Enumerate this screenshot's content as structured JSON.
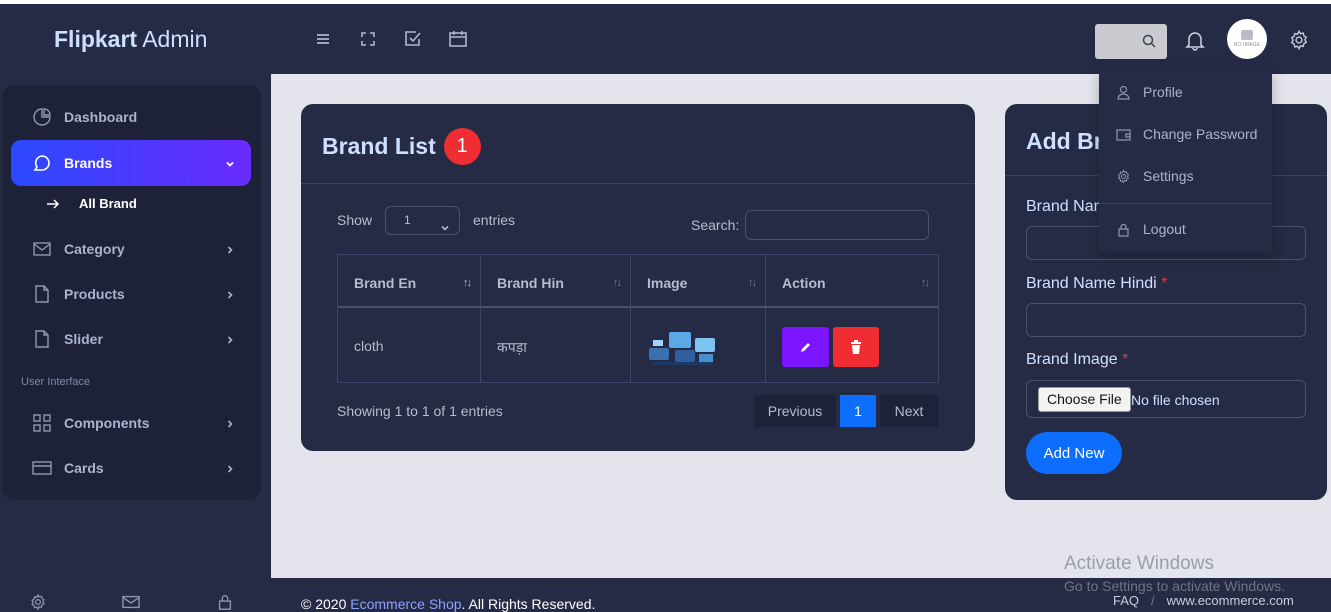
{
  "app": {
    "brand_bold": "Flipkart",
    "brand_rest": " Admin"
  },
  "topbar": {
    "icons": [
      "menu-icon",
      "fullscreen-icon",
      "checkbox-icon",
      "calendar-icon"
    ],
    "search_icon": "search-icon",
    "avatar_text": "NO IMAGE"
  },
  "sidebar": {
    "items": [
      {
        "label": "Dashboard",
        "icon": "pie-chart-icon"
      },
      {
        "label": "Brands",
        "icon": "chat-icon"
      },
      {
        "label": "Category",
        "icon": "mail-icon"
      },
      {
        "label": "Products",
        "icon": "file-icon"
      },
      {
        "label": "Slider",
        "icon": "file-icon"
      },
      {
        "label": "Components",
        "icon": "grid-icon"
      },
      {
        "label": "Cards",
        "icon": "card-icon"
      }
    ],
    "sub_item": "All Brand",
    "section_label": "User Interface"
  },
  "brand_list": {
    "title": "Brand List",
    "badge": "1",
    "show_label": "Show",
    "show_value": "1",
    "entries_label": "entries",
    "search_label": "Search:",
    "columns": [
      "Brand En",
      "Brand Hin",
      "Image",
      "Action"
    ],
    "rows": [
      {
        "brand_en": "cloth",
        "brand_hin": "कपड़ा"
      }
    ],
    "info": "Showing 1 to 1 of 1 entries",
    "pagination": {
      "prev": "Previous",
      "page": "1",
      "next": "Next"
    }
  },
  "add_brand": {
    "title": "Add Br",
    "label_en": "Brand Nan",
    "label_hin": "Brand Name Hindi",
    "label_image": "Brand Image",
    "required": "*",
    "choose_file": "Choose File",
    "no_file": "No file chosen",
    "submit": "Add New"
  },
  "dropdown": {
    "items": [
      {
        "label": "Profile",
        "icon": "user-icon"
      },
      {
        "label": "Change Password",
        "icon": "wallet-icon"
      },
      {
        "label": "Settings",
        "icon": "gear-icon"
      },
      {
        "label": "Logout",
        "icon": "lock-icon"
      }
    ]
  },
  "footer": {
    "prefix": "© 2020 ",
    "link": "Ecommerce Shop",
    "suffix": ". All Rights Reserved.",
    "faq": "FAQ",
    "divider": "/",
    "site": "www.ecommerce.com"
  },
  "watermark": {
    "title": "Activate Windows",
    "subtitle": "Go to Settings to activate Windows."
  },
  "colors": {
    "accent": "#0d6efd",
    "danger": "#ef2d33",
    "edit": "#7b14ff",
    "panel": "#262b45"
  }
}
